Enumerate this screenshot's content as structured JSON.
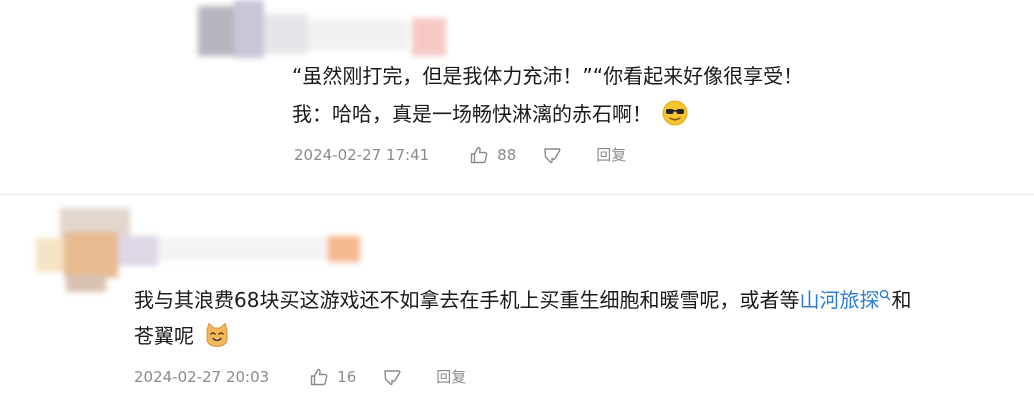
{
  "comments": [
    {
      "line1": "“虽然刚打完，但是我体力充沛！”“你看起来好像很享受！",
      "line2": "我：哈哈，真是一场畅快淋漓的赤石啊！",
      "emoji": "sunglasses-emoji",
      "time": "2024-02-27 17:41",
      "likes": "88",
      "reply_label": "回复"
    },
    {
      "line1_before": "我与其浪费68块买这游戏还不如拿去在手机上买重生细胞和暖雪呢，或者等",
      "link": "山河旅探",
      "link_icon": "search-icon",
      "line1_after": "和",
      "line2": "苍翼呢",
      "emoji": "cat-emoji",
      "time": "2024-02-27 20:03",
      "likes": "16",
      "reply_label": "回复"
    }
  ],
  "colors": {
    "link": "#2b7cd3",
    "meta": "#8a8a8a",
    "text": "#1a1a1a"
  }
}
